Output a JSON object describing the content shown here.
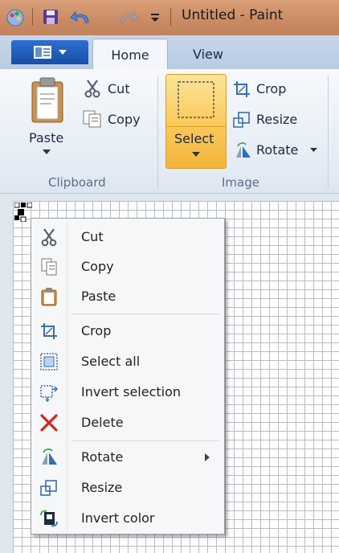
{
  "window": {
    "title": "Untitled - Paint"
  },
  "quick_access": [
    "paint-app-icon",
    "save-icon",
    "undo-icon",
    "redo-icon",
    "customize-dropdown-icon"
  ],
  "ribbon_tabs": {
    "file_icon": "file-menu-icon",
    "home": "Home",
    "view": "View"
  },
  "clipboard": {
    "paste": "Paste",
    "cut": "Cut",
    "copy": "Copy",
    "label": "Clipboard"
  },
  "image": {
    "select": "Select",
    "crop": "Crop",
    "resize": "Resize",
    "rotate": "Rotate",
    "label": "Image"
  },
  "context_menu": {
    "items": [
      {
        "label": "Cut",
        "icon": "scissors-icon"
      },
      {
        "label": "Copy",
        "icon": "copy-icon"
      },
      {
        "label": "Paste",
        "icon": "clipboard-icon"
      },
      {
        "label": "Crop",
        "icon": "crop-icon"
      },
      {
        "label": "Select all",
        "icon": "select-all-icon"
      },
      {
        "label": "Invert selection",
        "icon": "invert-selection-icon"
      },
      {
        "label": "Delete",
        "icon": "delete-x-icon"
      },
      {
        "label": "Rotate",
        "icon": "rotate-icon"
      },
      {
        "label": "Resize",
        "icon": "resize-icon"
      },
      {
        "label": "Invert color",
        "icon": "invert-color-icon"
      }
    ]
  },
  "colors": {
    "select_highlight": "#f7c04a",
    "delete_red": "#d8261c",
    "file_tab": "#1f5fbf",
    "titlebar": "#c98a63"
  }
}
